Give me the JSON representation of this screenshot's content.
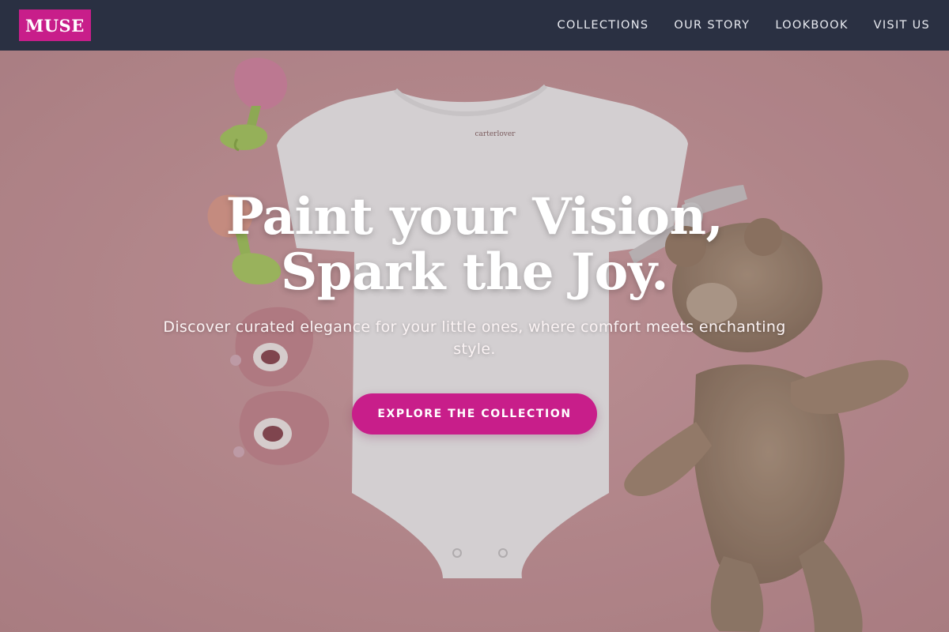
{
  "brand": {
    "logo_text": "MUSE",
    "accent_color": "#c81e8a",
    "nav_bg_color": "#2a3042"
  },
  "nav": {
    "items": [
      {
        "label": "COLLECTIONS"
      },
      {
        "label": "OUR STORY"
      },
      {
        "label": "LOOKBOOK"
      },
      {
        "label": "VISIT US"
      }
    ]
  },
  "hero": {
    "headline_line1": "Paint your Vision,",
    "headline_line2": "Spark the Joy.",
    "subheadline": "Discover curated elegance for your little ones, where comfort meets enchanting style.",
    "cta_label": "EXPLORE THE COLLECTION",
    "background": "pink backdrop with white baby bodysuit, pink teethers, baby shoes and a teddy bear"
  }
}
